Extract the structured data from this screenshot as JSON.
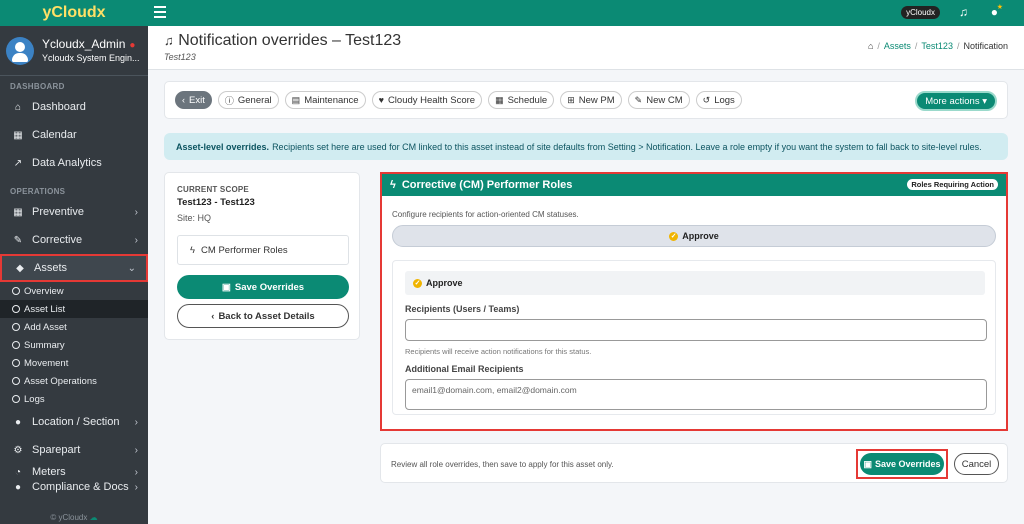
{
  "sidebar": {
    "brand": "yCloudx",
    "user_name": "Ycloudx_Admin",
    "user_role": "Ycloudx System Engin...",
    "sec_dashboard": "DASHBOARD",
    "sec_operations": "OPERATIONS",
    "dashboard": "Dashboard",
    "calendar": "Calendar",
    "analytics": "Data Analytics",
    "preventive": "Preventive",
    "corrective": "Corrective",
    "assets": "Assets",
    "sub": [
      "Overview",
      "Asset List",
      "Add Asset",
      "Summary",
      "Movement",
      "Asset Operations",
      "Logs"
    ],
    "location": "Location / Section",
    "sparepart": "Sparepart",
    "meters": "Meters",
    "compliance": "Compliance & Docs",
    "footer": "© yCloudx"
  },
  "topbar": {
    "badge": "yCloudx"
  },
  "header": {
    "title": "Notification overrides – Test123",
    "subtitle": "Test123",
    "crumb_assets": "Assets",
    "crumb_asset": "Test123",
    "crumb_current": "Notification"
  },
  "toolbar": {
    "exit": "Exit",
    "general": "General",
    "maintenance": "Maintenance",
    "health": "Cloudy Health Score",
    "schedule": "Schedule",
    "new_pm": "New PM",
    "new_cm": "New CM",
    "logs": "Logs",
    "more": "More actions"
  },
  "info": {
    "bold": "Asset-level overrides.",
    "text": "Recipients set here are used for CM linked to this asset instead of site defaults from Setting > Notification. Leave a role empty if you want the system to fall back to site-level rules."
  },
  "scope": {
    "label": "CURRENT SCOPE",
    "name": "Test123 - Test123",
    "site": "Site: HQ",
    "role": "CM Performer Roles",
    "save": "Save Overrides",
    "back": "Back to Asset Details"
  },
  "cm": {
    "title": "Corrective (CM) Performer Roles",
    "badge": "Roles Requiring Action",
    "desc": "Configure recipients for action-oriented CM statuses.",
    "pill": "Approve",
    "section": "Approve",
    "recipients_label": "Recipients (Users / Teams)",
    "recipients_value": "",
    "recipients_help": "Recipients will receive action notifications for this status.",
    "email_label": "Additional Email Recipients",
    "email_placeholder": "email1@domain.com, email2@domain.com"
  },
  "footer": {
    "text": "Review all role overrides, then save to apply for this asset only.",
    "save": "Save Overrides",
    "cancel": "Cancel"
  },
  "colors": {
    "accent": "#0b8a74",
    "highlight": "#e53935",
    "sidebar": "#343a40"
  }
}
